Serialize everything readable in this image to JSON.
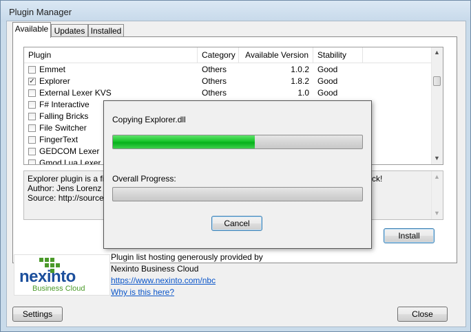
{
  "window": {
    "title": "Plugin Manager"
  },
  "tabs": [
    {
      "label": "Available",
      "active": true
    },
    {
      "label": "Updates",
      "active": false
    },
    {
      "label": "Installed",
      "active": false
    }
  ],
  "plugin_list": {
    "columns": [
      "Plugin",
      "Category",
      "Available Version",
      "Stability"
    ],
    "rows": [
      {
        "checked": false,
        "name": "Emmet",
        "category": "Others",
        "version": "1.0.2",
        "stability": "Good"
      },
      {
        "checked": true,
        "name": "Explorer",
        "category": "Others",
        "version": "1.8.2",
        "stability": "Good"
      },
      {
        "checked": false,
        "name": "External Lexer KVS",
        "category": "Others",
        "version": "1.0",
        "stability": "Good"
      },
      {
        "checked": false,
        "name": "F# Interactive",
        "category": "",
        "version": "",
        "stability": ""
      },
      {
        "checked": false,
        "name": "Falling Bricks",
        "category": "",
        "version": "",
        "stability": ""
      },
      {
        "checked": false,
        "name": "File Switcher",
        "category": "",
        "version": "",
        "stability": ""
      },
      {
        "checked": false,
        "name": "FingerText",
        "category": "",
        "version": "",
        "stability": ""
      },
      {
        "checked": false,
        "name": "GEDCOM Lexer",
        "category": "",
        "version": "",
        "stability": ""
      },
      {
        "checked": false,
        "name": "Gmod Lua Lexer",
        "category": "",
        "version": "",
        "stability": ""
      }
    ]
  },
  "description": {
    "lines": [
      "Explorer plugin is a file",
      "Author: Jens Lorenz",
      "Source: http://sourcefo"
    ],
    "trailing_fragment": "ck!"
  },
  "buttons": {
    "install": "Install",
    "settings": "Settings",
    "close": "Close"
  },
  "sponsor": {
    "logo_text_main": "nexinto",
    "logo_text_sub": "Business Cloud",
    "line1": "Plugin list hosting generously provided by",
    "line2": "Nexinto Business Cloud",
    "link_url": "https://www.nexinto.com/nbc",
    "link_why": "Why is this here?"
  },
  "progress_dialog": {
    "file_label": "Copying Explorer.dll",
    "file_progress": 0.57,
    "overall_label": "Overall Progress:",
    "overall_progress": 0,
    "cancel_label": "Cancel"
  },
  "colors": {
    "progress_green": "#1ec42f",
    "link_blue": "#0a55c9",
    "logo_blue": "#1c4f9c",
    "logo_green": "#4b9a2a"
  }
}
